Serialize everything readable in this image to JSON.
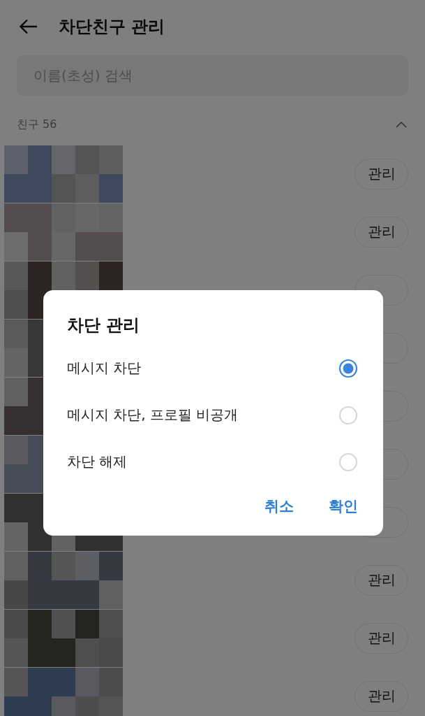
{
  "header": {
    "title": "차단친구 관리"
  },
  "search": {
    "placeholder": "이름(초성) 검색"
  },
  "section": {
    "label": "친구 56",
    "expanded": true
  },
  "rows": [
    {
      "kind": "button",
      "button": "관리"
    },
    {
      "kind": "button",
      "button": "관리"
    },
    {
      "kind": "covered"
    },
    {
      "kind": "covered"
    },
    {
      "kind": "covered"
    },
    {
      "kind": "covered"
    },
    {
      "kind": "covered"
    },
    {
      "kind": "button",
      "button": "관리"
    },
    {
      "kind": "button",
      "button": "관리"
    },
    {
      "kind": "button",
      "button": "관리"
    }
  ],
  "dialog": {
    "title": "차단 관리",
    "options": [
      {
        "label": "메시지 차단",
        "selected": true
      },
      {
        "label": "메시지 차단, 프로필 비공개",
        "selected": false
      },
      {
        "label": "차단 해제",
        "selected": false
      }
    ],
    "buttons": [
      "취소",
      "확인"
    ]
  }
}
